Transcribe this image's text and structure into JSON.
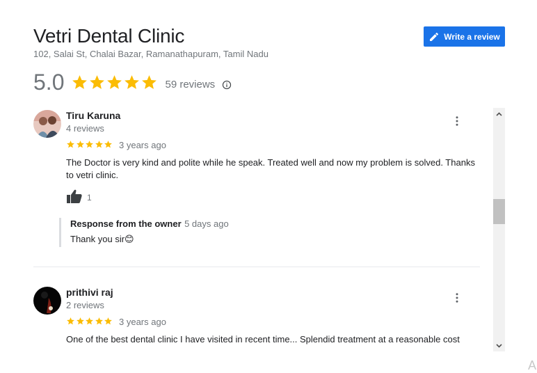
{
  "business": {
    "name": "Vetri Dental Clinic",
    "address": "102, Salai St, Chalai Bazar, Ramanathapuram, Tamil Nadu",
    "rating": "5.0",
    "stars": 5,
    "review_count": "59 reviews"
  },
  "write_review": {
    "label": "Write a review",
    "icon": "pencil-icon",
    "color": "#1a73e8"
  },
  "colors": {
    "star": "#fbbc04",
    "muted": "#70757a",
    "text": "#202124"
  },
  "reviews": [
    {
      "name": "Tiru Karuna",
      "meta": "4 reviews",
      "stars": 5,
      "date": "3 years ago",
      "text": "The Doctor is very kind and polite while he speak. Treated well and now my problem is solved. Thanks to vetri clinic.",
      "likes": "1",
      "owner_response": {
        "label": "Response from the owner",
        "date": "5 days ago",
        "text": "Thank you sir😊"
      }
    },
    {
      "name": "prithivi raj",
      "meta": "2 reviews",
      "stars": 5,
      "date": "3 years ago",
      "text": "One of the best dental clinic I have visited in recent time... Splendid treatment at a reasonable cost"
    }
  ],
  "corner_glyph": "A"
}
